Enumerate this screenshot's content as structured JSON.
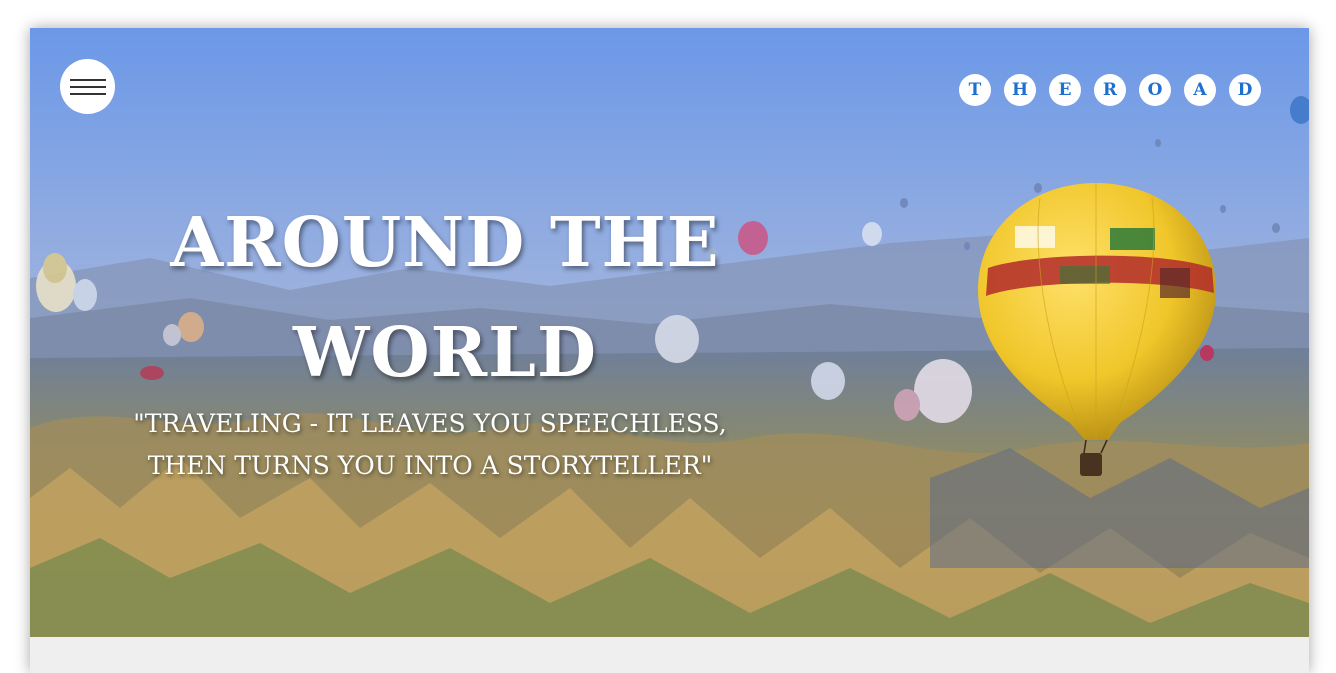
{
  "header": {
    "menu_icon": "hamburger-icon",
    "logo_letters": [
      "T",
      "H",
      "E",
      "R",
      "O",
      "A",
      "D"
    ]
  },
  "hero": {
    "title_line1": "AROUND THE",
    "title_line2": "WORLD",
    "quote_line1": "\"TRAVELING - IT LEAVES YOU SPEECHLESS,",
    "quote_line2": "THEN TURNS YOU INTO A STORYTELLER\""
  },
  "colors": {
    "sky_top": "#6f9ae6",
    "sky_bottom": "#9fb3dc",
    "logo_text": "#1f6fd1",
    "balloon_yellow": "#f0c62a",
    "page_background": "#efefef"
  }
}
